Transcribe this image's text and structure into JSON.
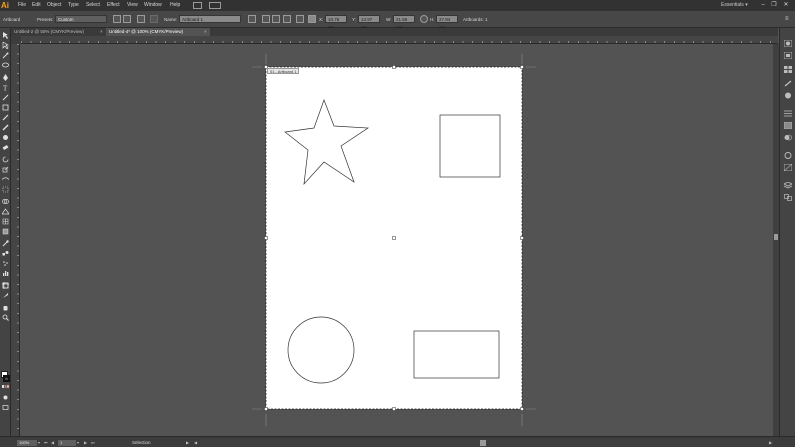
{
  "app": {
    "logo": "Ai",
    "workspace": "Essentials",
    "workspace_arrow": "▾"
  },
  "menu": [
    "File",
    "Edit",
    "Object",
    "Type",
    "Select",
    "Effect",
    "View",
    "Window",
    "Help"
  ],
  "window_controls": {
    "minimize": "–",
    "restore": "❐",
    "close": "✕"
  },
  "control_bar": {
    "mode_label": "Artboard",
    "presets_label": "Presets:",
    "presets_value": "Custom",
    "name_label": "Name:",
    "name_value": "Artboard 1",
    "x_label": "X:",
    "x_value": "10.76 cm",
    "y_label": "Y:",
    "y_value": "13.97 cm",
    "w_label": "W:",
    "w_value": "21.66 cm",
    "h_label": "H:",
    "h_value": "27.94 cm",
    "artboards_label": "Artboards: 1"
  },
  "tabs": [
    {
      "label": "Untitled-2 @ 50% (CMYK/Preview)",
      "close": "×"
    },
    {
      "label": "Untitled-4* @ 100% (CMYK/Preview)",
      "close": "×"
    }
  ],
  "artboard": {
    "label": "01 - Artboard 1",
    "background": "#ffffff"
  },
  "status_bar": {
    "zoom": "100%",
    "page": "1",
    "tool_label": "Selection"
  },
  "colors": {
    "chrome_dark": "#323232",
    "chrome_mid": "#474747",
    "canvas_bg": "#535353",
    "accent_logo": "#f7a21b",
    "shape_stroke": "#333333"
  }
}
